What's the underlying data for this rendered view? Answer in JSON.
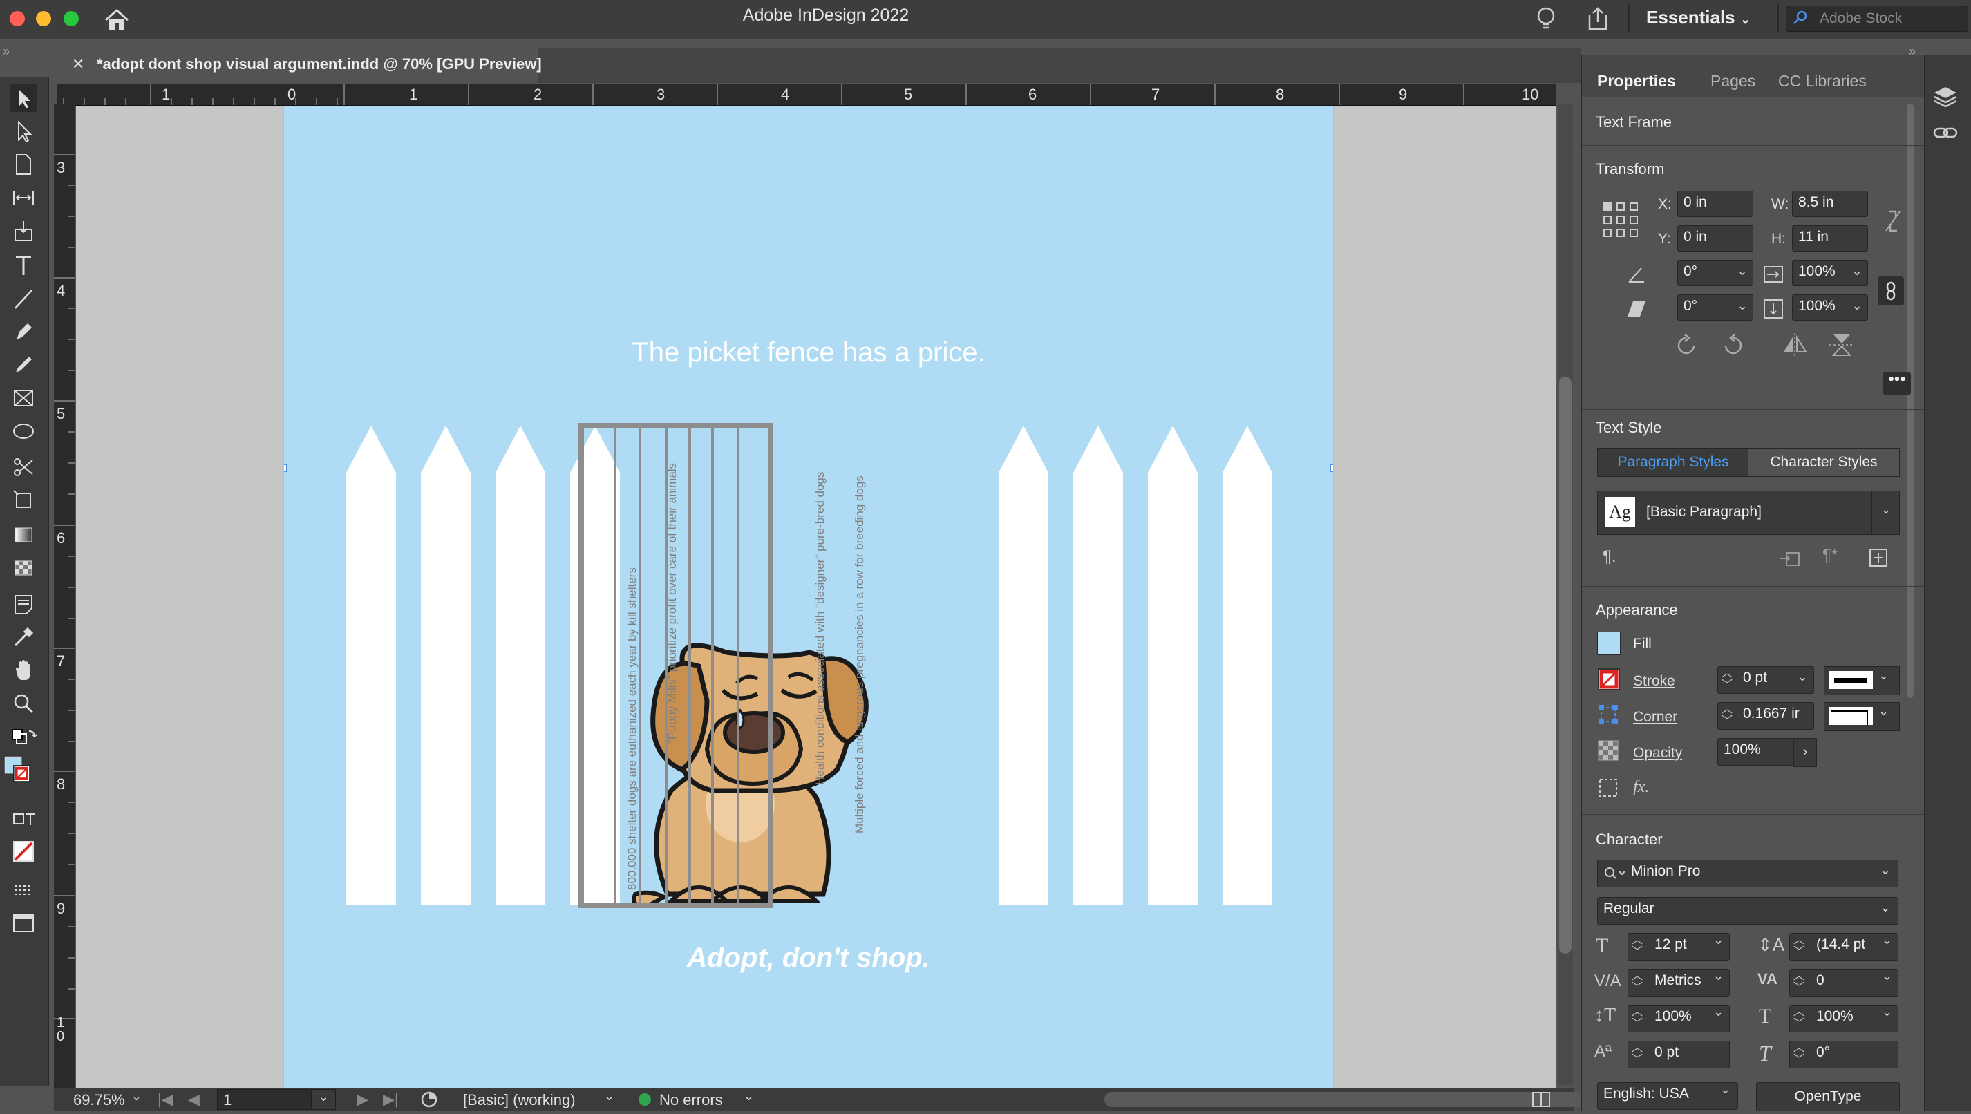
{
  "app": {
    "title": "Adobe InDesign 2022",
    "workspace": "Essentials",
    "stock_search_placeholder": "Adobe Stock"
  },
  "document": {
    "tab_title": "*adopt dont shop visual argument.indd @ 70% [GPU Preview]"
  },
  "ruler": {
    "top": [
      "1",
      "0",
      "1",
      "2",
      "3",
      "4",
      "5",
      "6",
      "7",
      "8",
      "9",
      "10"
    ],
    "left": [
      "3",
      "4",
      "5",
      "6",
      "7",
      "8",
      "9",
      "10"
    ]
  },
  "poster": {
    "headline": "The picket fence has a price.",
    "tagline": "Adopt, don't shop.",
    "bar_texts": [
      "800,000 shelter dogs are euthanized each year by kill shelters",
      "\"Puppy Mills\" prioritize profit over care of their animals",
      "Health conditions associated with \"designer\" pure-bred dogs",
      "Multiple forced and angerous pregnancies in a row for breeding dogs"
    ],
    "colors": {
      "background": "#afdcf4",
      "fence": "#ffffff",
      "cage": "#8e8e8e",
      "dog": "#e0b27a"
    }
  },
  "status": {
    "zoom": "69.75%",
    "page": "1",
    "style": "[Basic] (working)",
    "preflight": "No errors"
  },
  "panel": {
    "tabs": [
      "Properties",
      "Pages",
      "CC Libraries"
    ],
    "active_tab": "Properties",
    "selection_type": "Text Frame",
    "transform": {
      "heading": "Transform",
      "x_label": "X:",
      "x": "0 in",
      "y_label": "Y:",
      "y": "0 in",
      "w_label": "W:",
      "w": "8.5 in",
      "h_label": "H:",
      "h": "11 in",
      "rotation": "0°",
      "shear": "0°",
      "scale_x": "100%",
      "scale_y": "100%"
    },
    "text_style": {
      "heading": "Text Style",
      "tabs": [
        "Paragraph Styles",
        "Character Styles"
      ],
      "paragraph_style": "[Basic Paragraph]",
      "style_icon_text": "Ag"
    },
    "appearance": {
      "heading": "Appearance",
      "fill_label": "Fill",
      "stroke_label": "Stroke",
      "stroke_value": "0 pt",
      "corner_label": "Corner",
      "corner_value": "0.1667 ir",
      "opacity_label": "Opacity",
      "opacity_value": "100%",
      "fx_label": "fx."
    },
    "character": {
      "heading": "Character",
      "font": "Minion Pro",
      "style": "Regular",
      "size": "12 pt",
      "leading": "(14.4 pt",
      "kerning": "Metrics",
      "tracking": "0",
      "vscale": "100%",
      "hscale": "100%",
      "baseline": "0 pt",
      "skew": "0°",
      "language": "English: USA",
      "opentype": "OpenType"
    }
  }
}
